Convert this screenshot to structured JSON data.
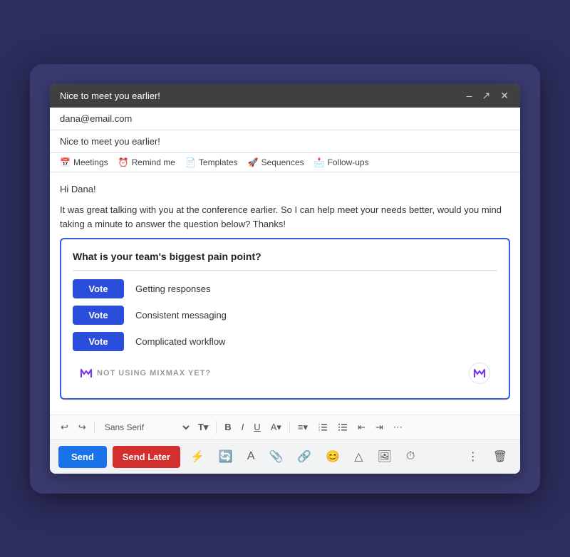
{
  "window": {
    "title": "Nice to meet you earlier!",
    "controls": [
      "minimize",
      "maximize",
      "close"
    ]
  },
  "email": {
    "to": "dana@email.com",
    "subject": "Nice to meet you earlier!",
    "body_greeting": "Hi Dana!",
    "body_text": "It was great talking with you at the conference earlier. So I can help meet your needs better, would you mind taking a minute to answer the question below? Thanks!"
  },
  "toolbar": {
    "meetings_label": "Meetings",
    "remind_me_label": "Remind me",
    "templates_label": "Templates",
    "sequences_label": "Sequences",
    "follow_ups_label": "Follow-ups"
  },
  "poll": {
    "question": "What is your team's biggest pain point?",
    "options": [
      {
        "label": "Vote",
        "text": "Getting responses"
      },
      {
        "label": "Vote",
        "text": "Consistent messaging"
      },
      {
        "label": "Vote",
        "text": "Complicated workflow"
      }
    ],
    "mixmax_cta": "NOT USING MIXMAX YET?"
  },
  "format_toolbar": {
    "undo": "↩",
    "redo": "↪",
    "font": "Sans Serif",
    "font_size_icon": "T",
    "bold": "B",
    "italic": "I",
    "underline": "U",
    "font_color": "A",
    "align": "≡",
    "ol": "1.",
    "ul": "•",
    "indent_left": "⇤",
    "indent_right": "⇥",
    "more": "⋯"
  },
  "actions": {
    "send_label": "Send",
    "send_later_label": "Send Later"
  }
}
